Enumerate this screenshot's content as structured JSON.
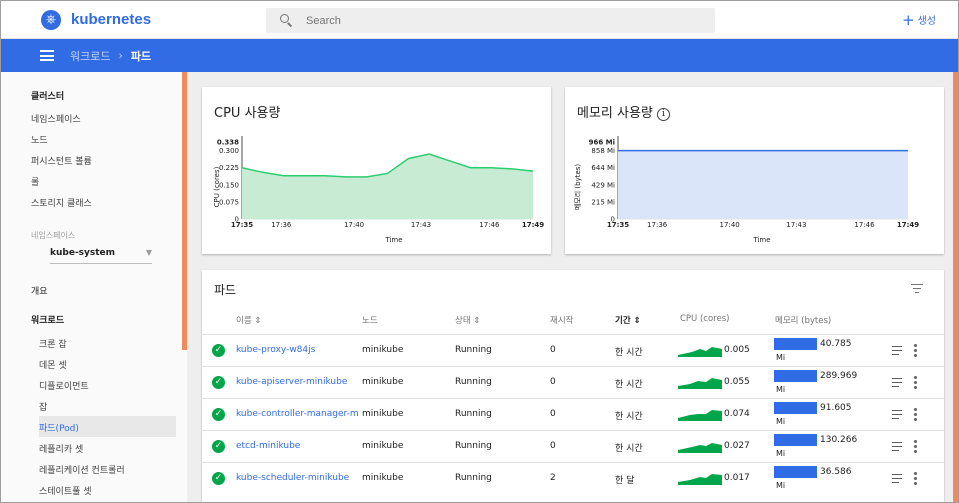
{
  "topbar": {
    "logo_text": "kubernetes",
    "search_placeholder": "Search",
    "create_label": "생성"
  },
  "breadcrumb": {
    "parent": "워크로드",
    "separator": "›",
    "current": "파드"
  },
  "sidebar": {
    "cluster_header": "클러스터",
    "cluster_items": [
      "네임스페이스",
      "노드",
      "퍼시스턴트 볼륨",
      "롤",
      "스토리지 클래스"
    ],
    "namespace_label": "네임스페이스",
    "namespace_value": "kube-system",
    "overview": "개요",
    "workloads_header": "워크로드",
    "workload_items": [
      "크론 잡",
      "데몬 셋",
      "디플로이먼트",
      "잡",
      "파드(Pod)",
      "레플리카 셋",
      "레플리케이션 컨트롤러",
      "스테이트풀 셋"
    ],
    "active_item": "파드(Pod)"
  },
  "colors": {
    "brand": "#326ce5",
    "cpu_line": "#2ecc71",
    "ok": "#00a74a",
    "scroll_accent": "#ef8a5d"
  },
  "cpu_card": {
    "title": "CPU 사용량",
    "ylabel": "CPU (cores)",
    "xlabel": "Time",
    "yticks": [
      "0.338",
      "0.300",
      "0.225",
      "0.150",
      "0.075",
      "0"
    ],
    "xticks": [
      "17:35",
      "17:36",
      "17:40",
      "17:43",
      "17:46",
      "17:49"
    ]
  },
  "mem_card": {
    "title": "메모리 사용량",
    "ylabel": "메모리 (bytes)",
    "xlabel": "Time",
    "yticks": [
      "966 Mi",
      "858 Mi",
      "644 Mi",
      "429 Mi",
      "215 Mi",
      "0"
    ],
    "xticks": [
      "17:35",
      "17:36",
      "17:40",
      "17:43",
      "17:46",
      "17:49"
    ]
  },
  "chart_data": [
    {
      "type": "area",
      "title": "CPU 사용량",
      "xlabel": "Time",
      "ylabel": "CPU (cores)",
      "ylim": [
        0,
        0.338
      ],
      "x": [
        "17:35",
        "17:36",
        "17:37",
        "17:38",
        "17:39",
        "17:40",
        "17:41",
        "17:42",
        "17:43",
        "17:44",
        "17:45",
        "17:46",
        "17:47",
        "17:48",
        "17:49"
      ],
      "series": [
        {
          "values": [
            0.225,
            0.205,
            0.19,
            0.19,
            0.19,
            0.185,
            0.185,
            0.2,
            0.265,
            0.285,
            0.255,
            0.225,
            0.225,
            0.22,
            0.21
          ]
        }
      ]
    },
    {
      "type": "area",
      "title": "메모리 사용량",
      "xlabel": "Time",
      "ylabel": "메모리 (bytes)",
      "ylim": [
        0,
        966
      ],
      "x": [
        "17:35",
        "17:49"
      ],
      "series": [
        {
          "values": [
            858,
            858
          ]
        }
      ]
    }
  ],
  "pods": {
    "title": "파드",
    "headers": {
      "name": "이름 ⇕",
      "node": "노드",
      "status": "상태 ⇕",
      "restarts": "재시작",
      "age": "기간 ⇕",
      "cpu": "CPU (cores)",
      "memory": "메모리 (bytes)"
    },
    "rows": [
      {
        "name": "kube-proxy-w84js",
        "node": "minikube",
        "status": "Running",
        "restarts": "0",
        "age": "한 시간",
        "cpu": "0.005",
        "memory": "40.785",
        "mem_unit": "Mi"
      },
      {
        "name": "kube-apiserver-minikube",
        "node": "minikube",
        "status": "Running",
        "restarts": "0",
        "age": "한 시간",
        "cpu": "0.055",
        "memory": "289.969",
        "mem_unit": "Mi"
      },
      {
        "name": "kube-controller-manager-m",
        "node": "minikube",
        "status": "Running",
        "restarts": "0",
        "age": "한 시간",
        "cpu": "0.074",
        "memory": "91.605",
        "mem_unit": "Mi"
      },
      {
        "name": "etcd-minikube",
        "node": "minikube",
        "status": "Running",
        "restarts": "0",
        "age": "한 시간",
        "cpu": "0.027",
        "memory": "130.266",
        "mem_unit": "Mi"
      },
      {
        "name": "kube-scheduler-minikube",
        "node": "minikube",
        "status": "Running",
        "restarts": "2",
        "age": "한 달",
        "cpu": "0.017",
        "memory": "36.586",
        "mem_unit": "Mi"
      }
    ]
  }
}
